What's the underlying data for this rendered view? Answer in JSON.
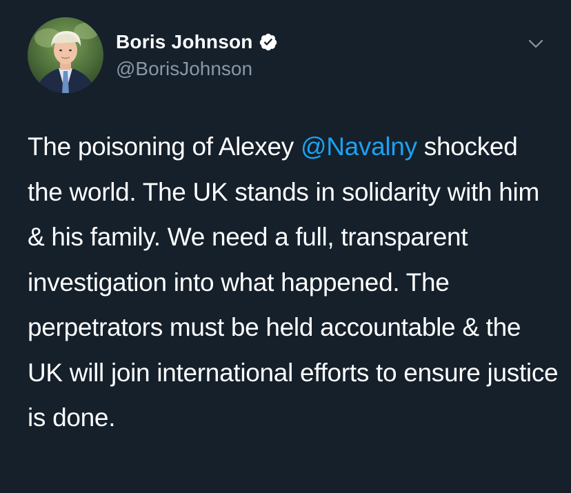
{
  "author": {
    "display_name": "Boris Johnson",
    "handle": "@BorisJohnson",
    "verified": true
  },
  "tweet": {
    "text_before": "The poisoning of Alexey ",
    "mention": "@Navalny",
    "text_after": " shocked the world. The UK stands in solidarity with him & his family. We need a full, transparent investigation into what happened. The perpetrators must be held accountable & the UK will join international efforts to ensure justice is done."
  },
  "icons": {
    "verified": "verified-badge-icon",
    "menu": "chevron-down-icon"
  },
  "colors": {
    "background": "#15202b",
    "text": "#ffffff",
    "secondary": "#8899a6",
    "link": "#1da1f2"
  }
}
